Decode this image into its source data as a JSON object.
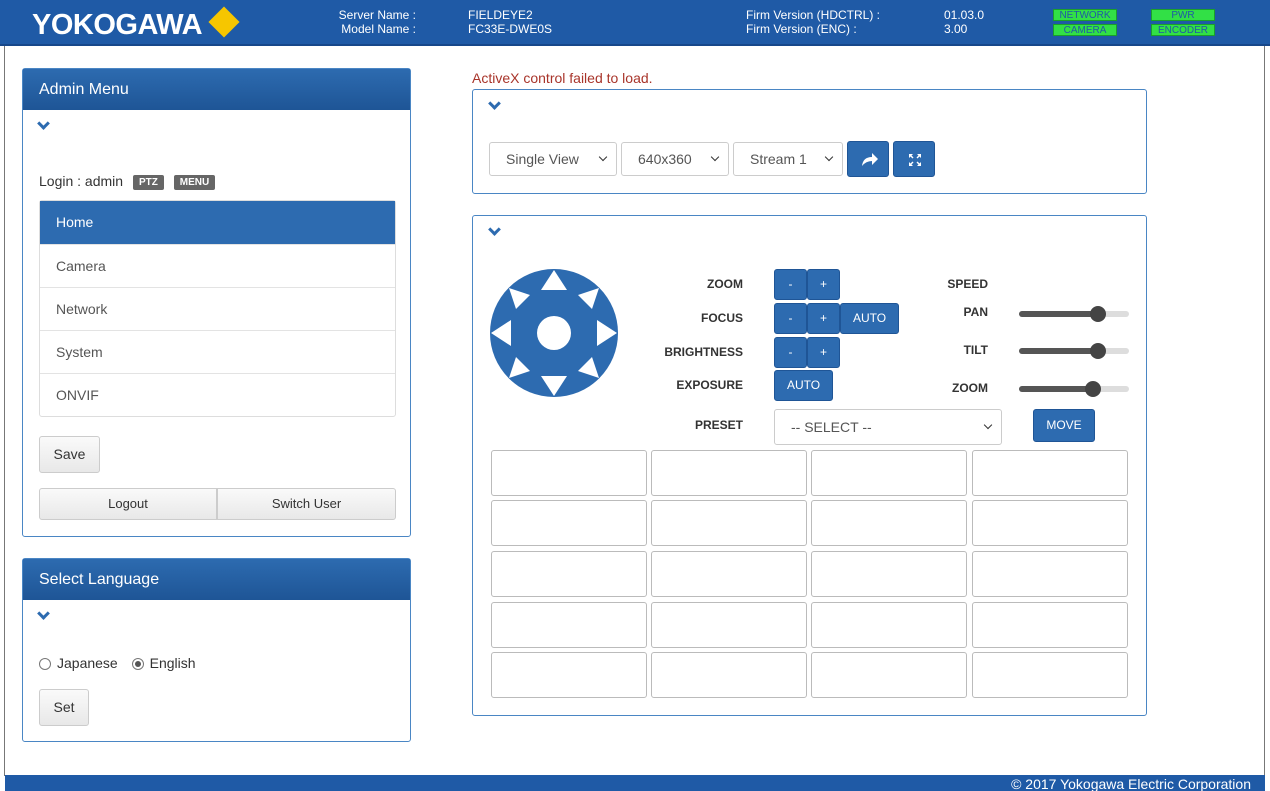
{
  "header": {
    "logo_text": "YOKOGAWA",
    "server_name_label": "Server Name :",
    "server_name_value": "FIELDEYE2",
    "model_name_label": "Model Name :",
    "model_name_value": "FC33E-DWE0S",
    "firm_hdctrl_label": "Firm Version (HDCTRL) :",
    "firm_hdctrl_value": "01.03.0",
    "firm_enc_label": "Firm Version (ENC) :",
    "firm_enc_value": "3.00",
    "status": {
      "network": "NETWORK",
      "pwr": "PWR",
      "camera": "CAMERA",
      "encoder": "ENCODER"
    },
    "status_color": "#32e046"
  },
  "admin_menu": {
    "title": "Admin Menu",
    "login_text": "Login : admin",
    "tag_ptz": "PTZ",
    "tag_menu": "MENU",
    "items": [
      {
        "label": "Home"
      },
      {
        "label": "Camera"
      },
      {
        "label": "Network"
      },
      {
        "label": "System"
      },
      {
        "label": "ONVIF"
      }
    ],
    "save_label": "Save",
    "logout_label": "Logout",
    "switch_user_label": "Switch User"
  },
  "language": {
    "title": "Select Language",
    "japanese": "Japanese",
    "english": "English",
    "selected": "English",
    "set_label": "Set"
  },
  "main": {
    "error_text": "ActiveX control failed to load.",
    "view_select": "Single View",
    "resolution_select": "640x360",
    "stream_select": "Stream 1"
  },
  "ptz": {
    "zoom_label": "ZOOM",
    "focus_label": "FOCUS",
    "brightness_label": "BRIGHTNESS",
    "exposure_label": "EXPOSURE",
    "preset_label": "PRESET",
    "minus": "-",
    "plus": "+",
    "auto": "AUTO",
    "preset_select": "-- SELECT --",
    "move_label": "MOVE",
    "speed_label": "SPEED",
    "pan_label": "PAN",
    "tilt_label": "TILT",
    "zoom_speed_label": "ZOOM"
  },
  "footer": {
    "copyright": "© 2017 Yokogawa Electric Corporation"
  },
  "colors": {
    "brand_blue": "#1f5aa6",
    "accent": "#2d6bb0",
    "error": "#a8342a",
    "logo_diamond": "#f6c600"
  }
}
